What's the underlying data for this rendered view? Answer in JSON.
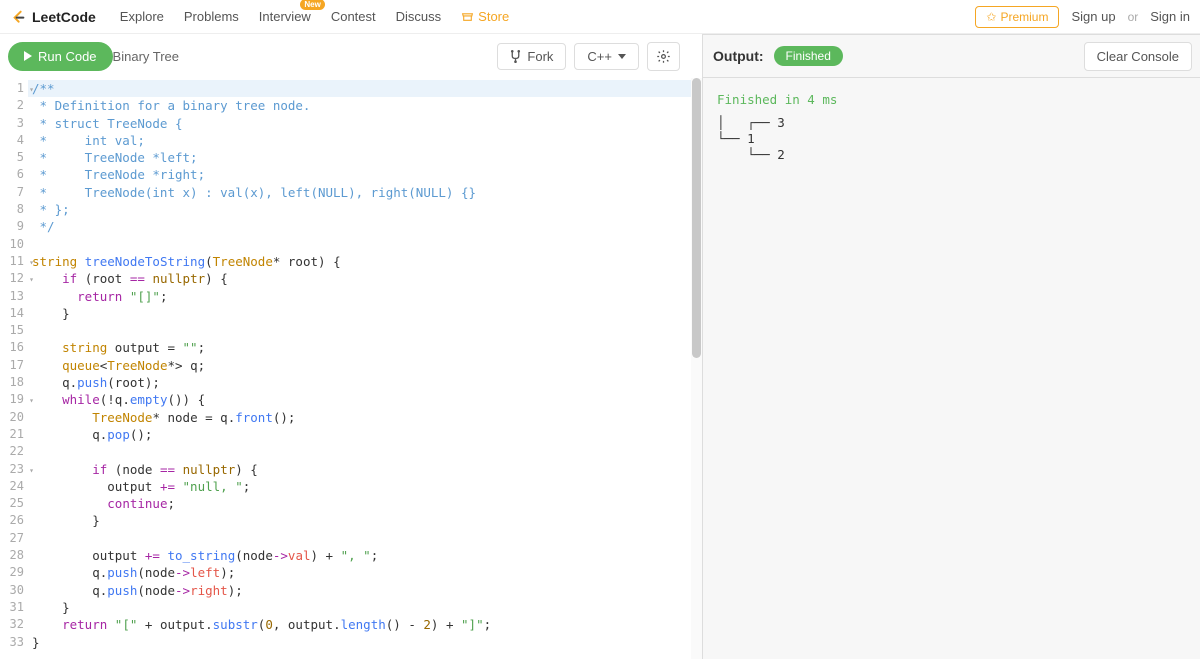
{
  "nav": {
    "brand": "LeetCode",
    "items": [
      "Explore",
      "Problems",
      "Interview",
      "Contest",
      "Discuss",
      "Store"
    ],
    "badge_new": "New",
    "premium": "Premium",
    "signup": "Sign up",
    "or": "or",
    "signin": "Sign in"
  },
  "toolbar": {
    "run": "Run Code",
    "title": "Binary Tree",
    "fork": "Fork",
    "language": "C++"
  },
  "output": {
    "label": "Output:",
    "status_pill": "Finished",
    "clear": "Clear Console",
    "status_line": "Finished in 4 ms",
    "tree": "│   ┌── 3\n└── 1\n    └── 2"
  },
  "code": {
    "lines": [
      {
        "n": 1,
        "fold": true,
        "hl": true,
        "html": "<span class='c-comment'>/**</span>"
      },
      {
        "n": 2,
        "html": "<span class='c-comment'> * Definition for a binary tree node.</span>"
      },
      {
        "n": 3,
        "html": "<span class='c-comment'> * struct TreeNode {</span>"
      },
      {
        "n": 4,
        "html": "<span class='c-comment'> *     int val;</span>"
      },
      {
        "n": 5,
        "html": "<span class='c-comment'> *     TreeNode *left;</span>"
      },
      {
        "n": 6,
        "html": "<span class='c-comment'> *     TreeNode *right;</span>"
      },
      {
        "n": 7,
        "html": "<span class='c-comment'> *     TreeNode(int x) : val(x), left(NULL), right(NULL) {}</span>"
      },
      {
        "n": 8,
        "html": "<span class='c-comment'> * };</span>"
      },
      {
        "n": 9,
        "html": "<span class='c-comment'> */</span>"
      },
      {
        "n": 10,
        "html": ""
      },
      {
        "n": 11,
        "fold": true,
        "html": "<span class='c-type'>string</span> <span class='c-func'>treeNodeToString</span>(<span class='c-type'>TreeNode</span>* root) {"
      },
      {
        "n": 12,
        "fold": true,
        "html": "    <span class='c-keyword'>if</span> (root <span class='c-op'>==</span> <span class='c-null'>nullptr</span>) {"
      },
      {
        "n": 13,
        "html": "      <span class='c-keyword'>return</span> <span class='c-string'>\"[]\"</span>;"
      },
      {
        "n": 14,
        "html": "    }"
      },
      {
        "n": 15,
        "html": ""
      },
      {
        "n": 16,
        "html": "    <span class='c-type'>string</span> output = <span class='c-string'>\"\"</span>;"
      },
      {
        "n": 17,
        "html": "    <span class='c-type'>queue</span>&lt;<span class='c-type'>TreeNode</span>*&gt; q;"
      },
      {
        "n": 18,
        "html": "    q.<span class='c-func'>push</span>(root);"
      },
      {
        "n": 19,
        "fold": true,
        "html": "    <span class='c-keyword'>while</span>(!q.<span class='c-func'>empty</span>()) {"
      },
      {
        "n": 20,
        "html": "        <span class='c-type'>TreeNode</span>* node = q.<span class='c-func'>front</span>();"
      },
      {
        "n": 21,
        "html": "        q.<span class='c-func'>pop</span>();"
      },
      {
        "n": 22,
        "html": ""
      },
      {
        "n": 23,
        "fold": true,
        "html": "        <span class='c-keyword'>if</span> (node <span class='c-op'>==</span> <span class='c-null'>nullptr</span>) {"
      },
      {
        "n": 24,
        "html": "          output <span class='c-op'>+=</span> <span class='c-string'>\"null, \"</span>;"
      },
      {
        "n": 25,
        "html": "          <span class='c-keyword'>continue</span>;"
      },
      {
        "n": 26,
        "html": "        }"
      },
      {
        "n": 27,
        "html": ""
      },
      {
        "n": 28,
        "html": "        output <span class='c-op'>+=</span> <span class='c-func'>to_string</span>(node<span class='c-op'>-&gt;</span><span class='c-prop'>val</span>) + <span class='c-string'>\", \"</span>;"
      },
      {
        "n": 29,
        "html": "        q.<span class='c-func'>push</span>(node<span class='c-op'>-&gt;</span><span class='c-prop'>left</span>);"
      },
      {
        "n": 30,
        "html": "        q.<span class='c-func'>push</span>(node<span class='c-op'>-&gt;</span><span class='c-prop'>right</span>);"
      },
      {
        "n": 31,
        "html": "    }"
      },
      {
        "n": 32,
        "html": "    <span class='c-keyword'>return</span> <span class='c-string'>\"[\"</span> + output.<span class='c-func'>substr</span>(<span class='c-number'>0</span>, output.<span class='c-func'>length</span>() - <span class='c-number'>2</span>) + <span class='c-string'>\"]\"</span>;"
      },
      {
        "n": 33,
        "html": "}"
      }
    ]
  }
}
